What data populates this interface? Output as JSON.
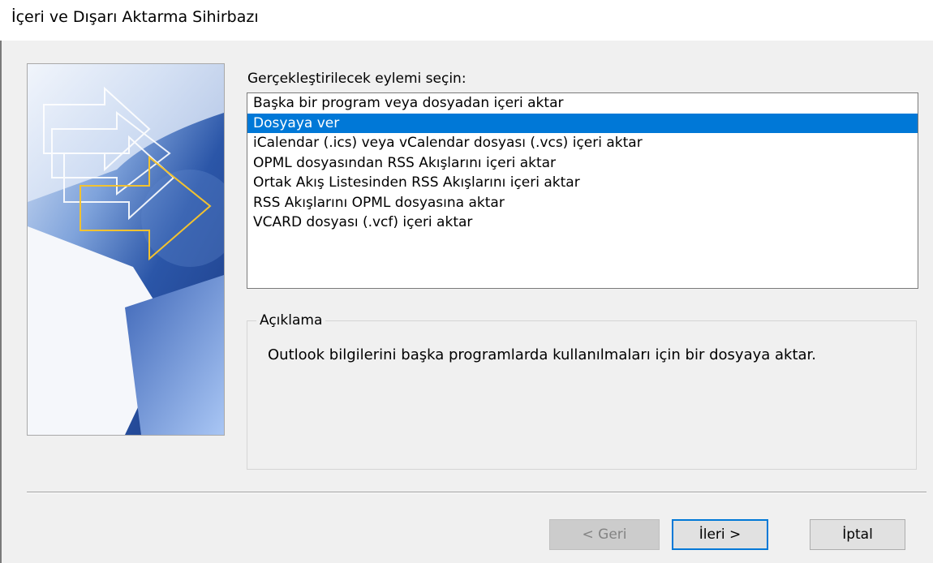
{
  "window": {
    "title": "İçeri ve Dışarı Aktarma Sihirbazı"
  },
  "prompt": "Gerçekleştirilecek eylemi seçin:",
  "actions": [
    {
      "label": "Başka bir program veya dosyadan içeri aktar",
      "selected": false
    },
    {
      "label": "Dosyaya ver",
      "selected": true
    },
    {
      "label": "iCalendar (.ics) veya vCalendar dosyası (.vcs) içeri aktar",
      "selected": false
    },
    {
      "label": "OPML dosyasından RSS Akışlarını içeri aktar",
      "selected": false
    },
    {
      "label": "Ortak Akış Listesinden RSS Akışlarını içeri aktar",
      "selected": false
    },
    {
      "label": "RSS Akışlarını OPML dosyasına aktar",
      "selected": false
    },
    {
      "label": "VCARD dosyası (.vcf) içeri aktar",
      "selected": false
    }
  ],
  "description": {
    "label": "Açıklama",
    "text": "Outlook bilgilerini başka programlarda kullanılmaları için bir dosyaya aktar."
  },
  "buttons": {
    "back": "< Geri",
    "next": "İleri >",
    "cancel": "İptal"
  },
  "colors": {
    "selection": "#0078d7",
    "default_button_border": "#0078d7",
    "banner_dark": "#1f3f86",
    "banner_light": "#9fbff0",
    "arrow_outline": "#f2c230"
  }
}
